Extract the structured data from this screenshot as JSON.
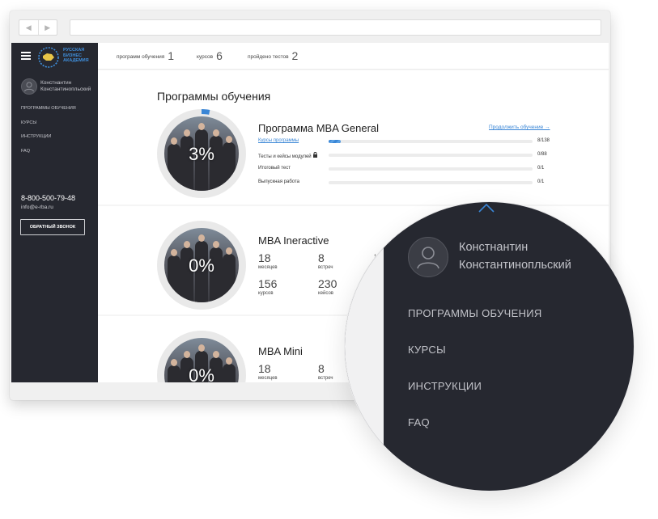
{
  "browser": {
    "back_icon": "◀",
    "forward_icon": "▶"
  },
  "sidebar": {
    "logo_text": [
      "РУССКАЯ",
      "БИЗНЕС",
      "АКАДЕМИЯ"
    ],
    "user_first": "Констнантин",
    "user_last": "Константинопльский",
    "menu": [
      "ПРОГРАММЫ ОБУЧЕНИЯ",
      "КУРСЫ",
      "ИНСТРУКЦИИ",
      "FAQ"
    ],
    "phone": "8-800-500-79-48",
    "email": "info@e-rba.ru",
    "callback_label": "ОБРАТНЫЙ ЗВОНОК"
  },
  "topbar": {
    "stats": [
      {
        "label": "программ обучения",
        "value": "1"
      },
      {
        "label": "курсов",
        "value": "6"
      },
      {
        "label": "пройдено тестов",
        "value": "2"
      }
    ]
  },
  "main": {
    "title": "Программы обучения",
    "programs": [
      {
        "name": "Программа MBA General",
        "percent": "3%",
        "progress_fraction": 0.03,
        "continue_label": "Продолжить обучение →",
        "rows": [
          {
            "label": "Курсы программы",
            "value": "8/138",
            "fraction": 0.058
          },
          {
            "label": "Тесты и кейсы модулей",
            "value": "0/88",
            "fraction": 0
          },
          {
            "label": "Итоговый тест",
            "value": "0/1",
            "fraction": 0
          },
          {
            "label": "Выпускная работа",
            "value": "0/1",
            "fraction": 0
          }
        ]
      },
      {
        "name": "MBA Ineractive",
        "percent": "0%",
        "stats": [
          {
            "value": "18",
            "label": "месяцев"
          },
          {
            "value": "8",
            "label": "встреч"
          },
          {
            "value": "156",
            "label": "курсов"
          },
          {
            "value": "230",
            "label": "кейсов"
          }
        ],
        "extra": "1"
      },
      {
        "name": "MBA Mini",
        "percent": "0%",
        "stats": [
          {
            "value": "18",
            "label": "месяцев"
          },
          {
            "value": "8",
            "label": "встреч"
          }
        ]
      }
    ]
  },
  "magnifier": {
    "user_first": "Констнантин",
    "user_last": "Константинопльский",
    "menu": [
      "ПРОГРАММЫ ОБУЧЕНИЯ",
      "КУРСЫ",
      "ИНСТРУКЦИИ",
      "FAQ"
    ]
  },
  "colors": {
    "sidebar_bg": "#262830",
    "accent": "#3a86d6"
  }
}
